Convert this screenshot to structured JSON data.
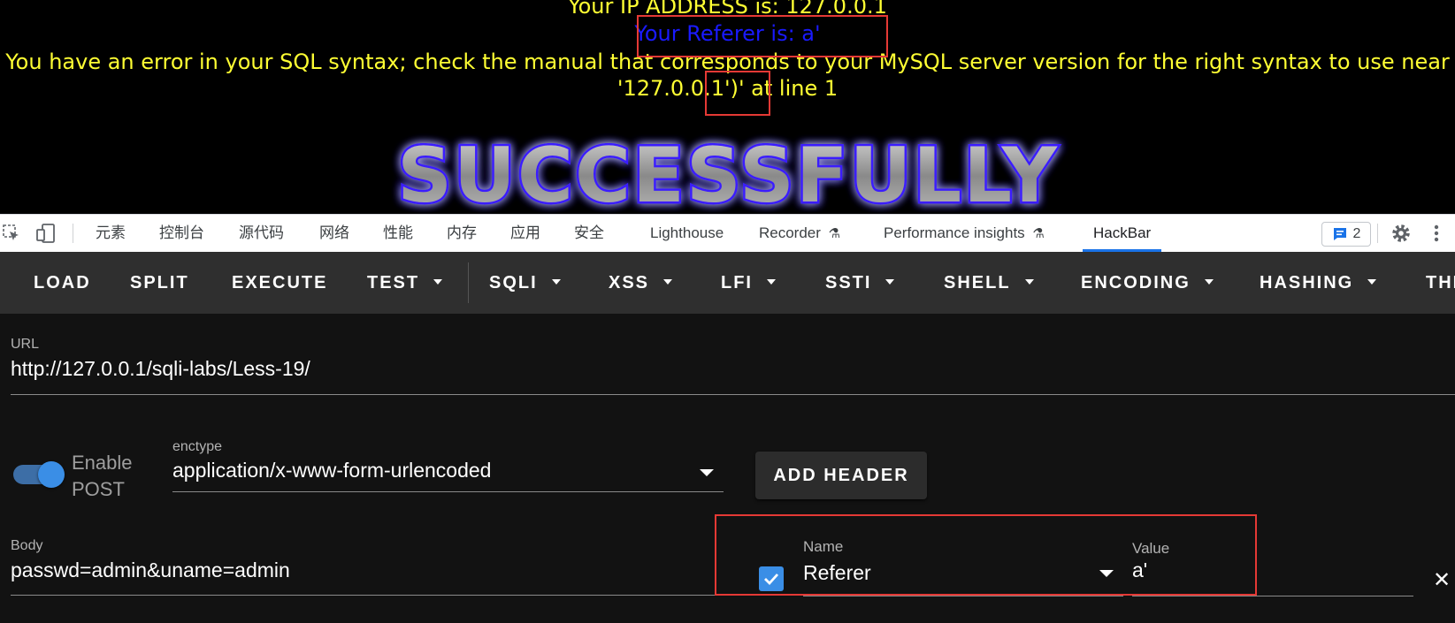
{
  "page": {
    "ip_line": "Your IP ADDRESS is: 127.0.0.1",
    "referer_line": "Your Referer is: a'",
    "error_line1": "You have an error in your SQL syntax; check the manual that corresponds to your MySQL server version for the right syntax to use near",
    "error_line2": "'127.0.0.1')' at line 1",
    "banner_text": "SUCCESSFULLY"
  },
  "devtools": {
    "tabs": [
      "元素",
      "控制台",
      "源代码",
      "网络",
      "性能",
      "内存",
      "应用",
      "安全",
      "Lighthouse",
      "Recorder",
      "Performance insights",
      "HackBar"
    ],
    "active_tab": "HackBar",
    "issues_count": "2"
  },
  "hackbar": {
    "toolbar": {
      "load": "LOAD",
      "split": "SPLIT",
      "execute": "EXECUTE",
      "test": "TEST",
      "sqli": "SQLI",
      "xss": "XSS",
      "lfi": "LFI",
      "ssti": "SSTI",
      "shell": "SHELL",
      "encoding": "ENCODING",
      "hashing": "HASHING",
      "theme_cut": "THE"
    },
    "url_label": "URL",
    "url_value": "http://127.0.0.1/sqli-labs/Less-19/",
    "enable_post_line1": "Enable",
    "enable_post_line2": "POST",
    "enable_post_on": true,
    "enctype_label": "enctype",
    "enctype_value": "application/x-www-form-urlencoded",
    "add_header_label": "ADD HEADER",
    "body_label": "Body",
    "body_value": "passwd=admin&uname=admin",
    "header": {
      "enabled": true,
      "name_label": "Name",
      "name_value": "Referer",
      "value_label": "Value",
      "value_value": "a'"
    }
  },
  "colors": {
    "highlight_box": "#e53935",
    "page_text": "#ffff33",
    "referer_text": "#1a1aff",
    "accent": "#3a8ee6"
  }
}
